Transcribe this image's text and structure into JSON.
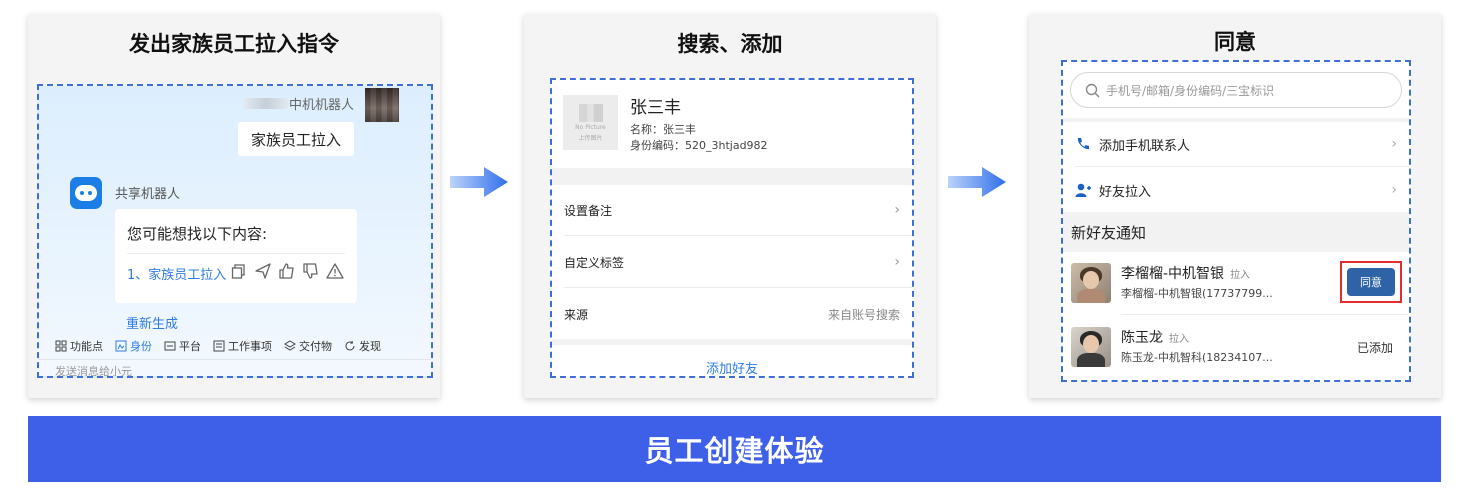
{
  "panels": {
    "p1": {
      "title": "发出家族员工拉入指令",
      "sender_name": "中机机器人",
      "command_text": "家族员工拉入",
      "bot_name": "共享机器人",
      "reply_intro": "您可能想找以下内容:",
      "reply_link": "1、家族员工拉入",
      "regenerate": "重新生成",
      "bottom_bar": [
        {
          "icon": "grid-icon",
          "label": "功能点",
          "active": false
        },
        {
          "icon": "id-card-icon",
          "label": "身份",
          "active": true
        },
        {
          "icon": "platform-icon",
          "label": "平台",
          "active": false
        },
        {
          "icon": "task-icon",
          "label": "工作事项",
          "active": false
        },
        {
          "icon": "layers-icon",
          "label": "交付物",
          "active": false
        },
        {
          "icon": "refresh-icon",
          "label": "发现",
          "active": false
        }
      ],
      "input_placeholder": "发送消息给小元"
    },
    "p2": {
      "title": "搜索、添加",
      "no_picture_text": "No Picture",
      "no_picture_sub": "上传图片",
      "name": "张三丰",
      "field_name": "名称：张三丰",
      "field_id": "身份编码：520_3htjad982",
      "rows": {
        "remark": "设置备注",
        "tags": "自定义标签",
        "source": "来源",
        "source_value": "来自账号搜索"
      },
      "add_button": "添加好友"
    },
    "p3": {
      "title": "同意",
      "search_placeholder": "手机号/邮箱/身份编码/三宝标识",
      "add_phone_contact": "添加手机联系人",
      "friend_pull": "好友拉入",
      "section_title": "新好友通知",
      "friends": [
        {
          "name": "李榴榴-中机智银",
          "tag": "拉入",
          "sub": "李榴榴-中机智银(17737799...",
          "action": "同意"
        },
        {
          "name": "陈玉龙",
          "tag": "拉入",
          "sub": "陈玉龙-中机智科(18234107...",
          "status": "已添加"
        }
      ]
    }
  },
  "banner_text": "员工创建体验",
  "colors": {
    "banner": "#3e60e9",
    "link": "#2f7ce6",
    "dashed_frame": "#3d6fd6",
    "agree_button": "#2e63a8",
    "highlight_box": "#e52d2d"
  }
}
